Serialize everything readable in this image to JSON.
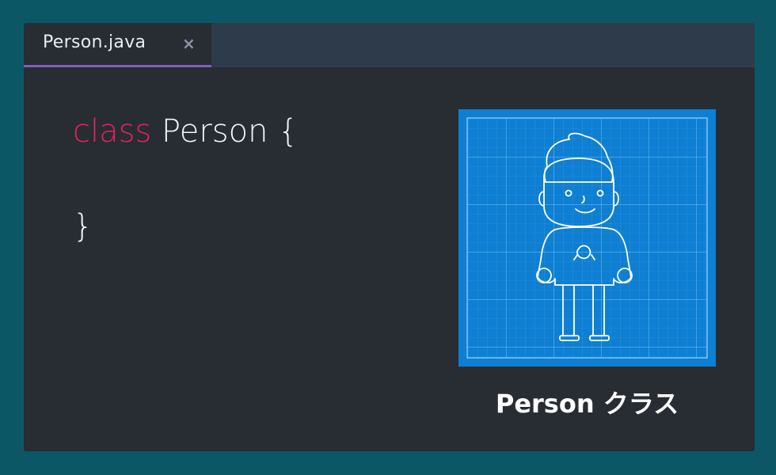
{
  "tab": {
    "filename": "Person.java",
    "close_glyph": "×"
  },
  "code": {
    "keyword": "class",
    "class_decl": " Person {",
    "closing": "}"
  },
  "illustration": {
    "caption": "Person クラス",
    "icon": "person-blueprint-icon"
  },
  "colors": {
    "background": "#0b5766",
    "editor": "#282c33",
    "keyword": "#e0245e",
    "tab_accent": "#7f5fbf",
    "blueprint": "#0e7fd2"
  }
}
